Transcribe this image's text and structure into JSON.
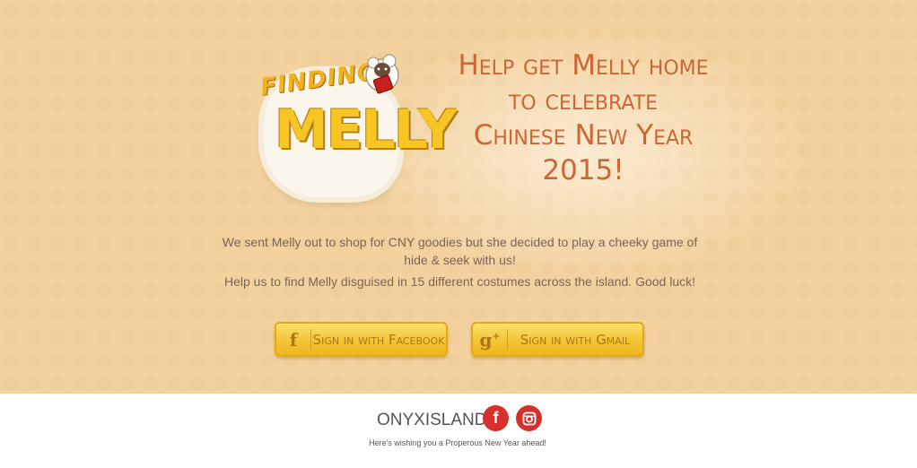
{
  "logo": {
    "finding": "FINDING",
    "melly": "MELLY"
  },
  "headline": {
    "line1": "Help get Melly home",
    "line2": "to celebrate",
    "line3": "Chinese New Year",
    "line4": "2015!"
  },
  "intro": {
    "paragraph1": "We sent Melly out to shop for CNY goodies but she decided to play a cheeky game of hide & seek with us!",
    "paragraph2": "Help us to find Melly disguised in 15 different costumes across the island. Good luck!"
  },
  "buttons": {
    "facebook": {
      "icon": "facebook-icon",
      "label": "Sign in with Facebook"
    },
    "gmail": {
      "icon": "google-plus-icon",
      "label": "Sign in with Gmail"
    }
  },
  "footer": {
    "brand": "ONYXISLAND",
    "social": [
      {
        "icon": "facebook-icon"
      },
      {
        "icon": "instagram-icon"
      }
    ],
    "tagline": "Here's wishing you a Properous New Year ahead!"
  },
  "colors": {
    "background": "#f3d2a0",
    "headline": "#cc6733",
    "button": "#f2c232",
    "social": "#d6302c"
  }
}
